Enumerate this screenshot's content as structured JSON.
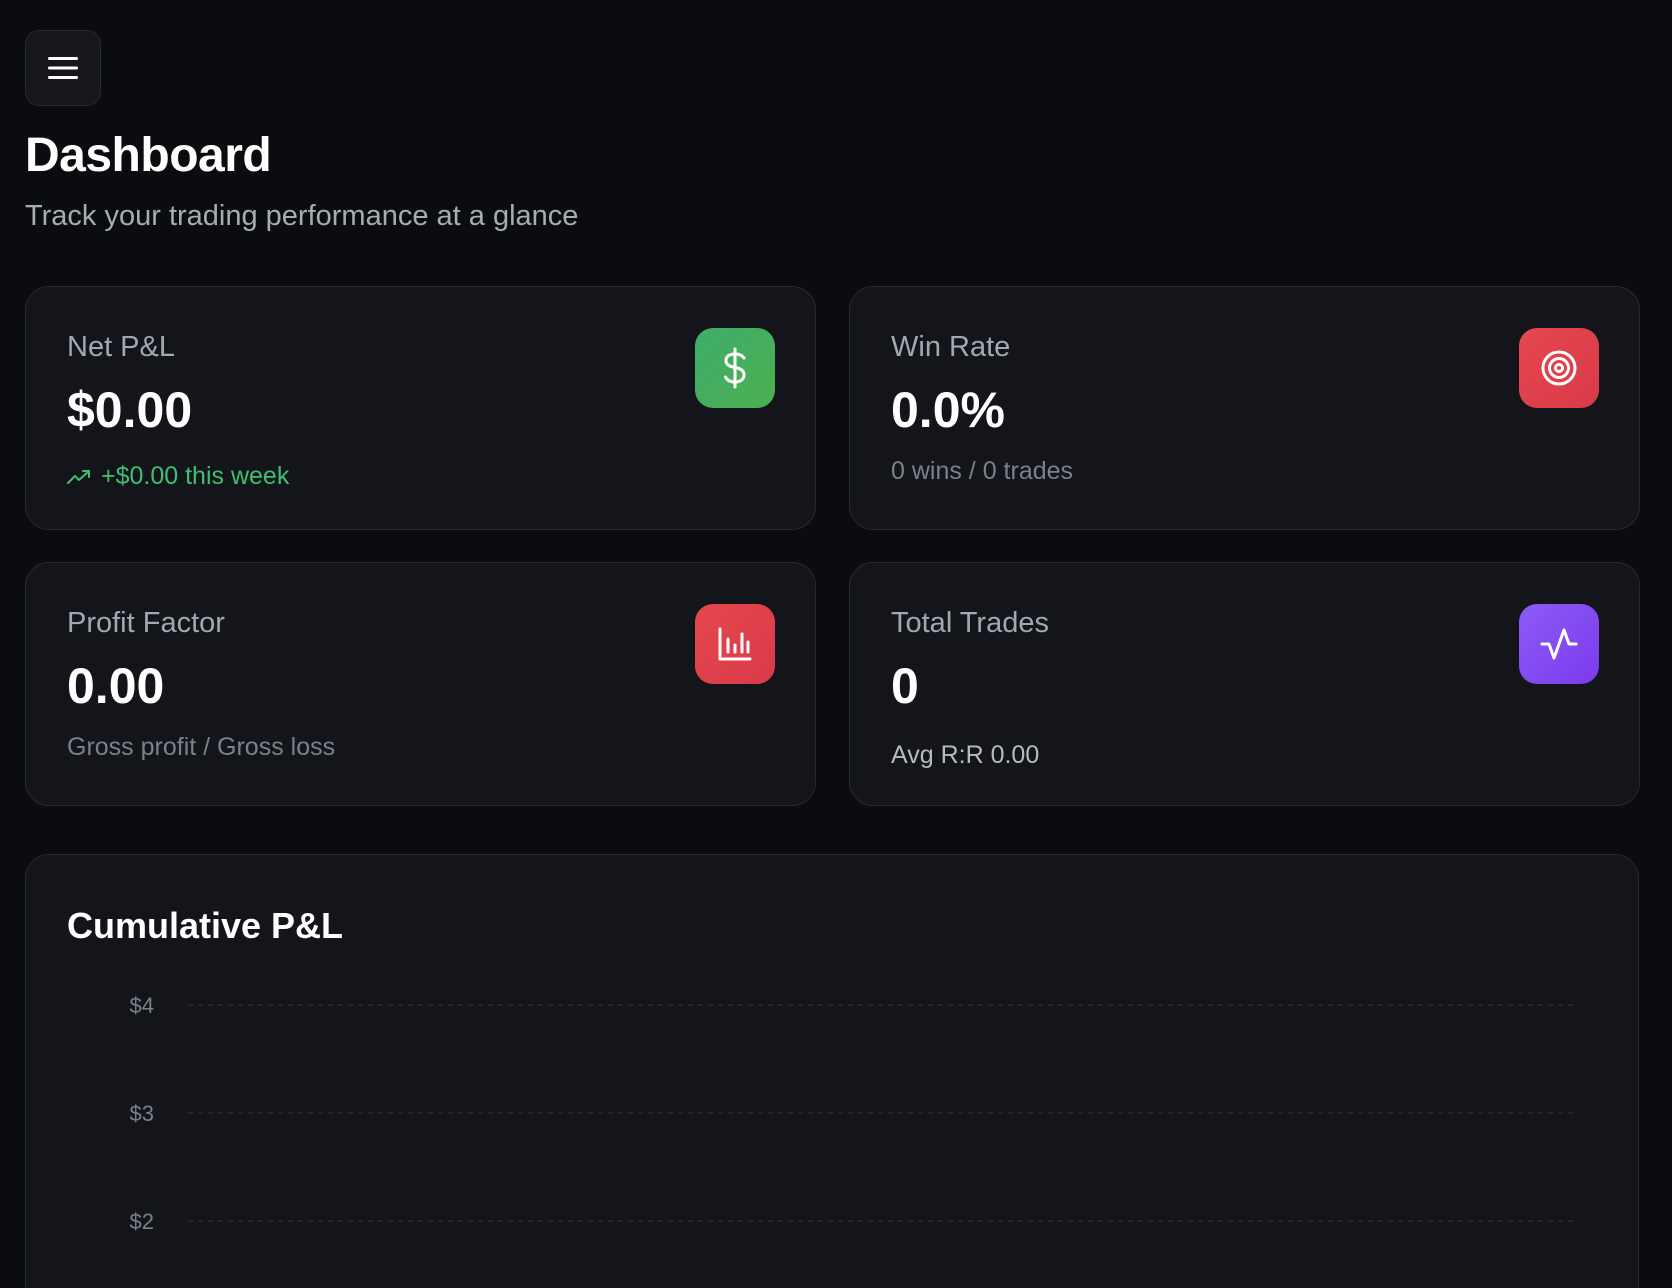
{
  "header": {
    "title": "Dashboard",
    "subtitle": "Track your trading performance at a glance",
    "menu_icon": "menu-icon"
  },
  "cards": {
    "net_pnl": {
      "label": "Net P&L",
      "value": "$0.00",
      "sub": "+$0.00 this week",
      "icon": "dollar-icon",
      "icon_color": [
        "#3fae6b",
        "#4caf50"
      ],
      "sub_color": "#3fbf73"
    },
    "win_rate": {
      "label": "Win Rate",
      "value": "0.0%",
      "sub": "0 wins / 0 trades",
      "icon": "target-icon",
      "icon_color": [
        "#e5484d",
        "#d93a4a"
      ]
    },
    "profit_factor": {
      "label": "Profit Factor",
      "value": "0.00",
      "sub": "Gross profit / Gross loss",
      "icon": "bar-chart-icon",
      "icon_color": [
        "#e5484d",
        "#d93a4a"
      ]
    },
    "total_trades": {
      "label": "Total Trades",
      "value": "0",
      "sub": "Avg R:R 0.00",
      "icon": "activity-icon",
      "icon_color": [
        "#8b5cf6",
        "#7c3aed"
      ]
    }
  },
  "chart_data": {
    "type": "line",
    "title": "Cumulative P&L",
    "y_ticks": [
      "$4",
      "$3",
      "$2"
    ],
    "ylim": [
      0,
      4
    ],
    "grid": true,
    "series": []
  }
}
